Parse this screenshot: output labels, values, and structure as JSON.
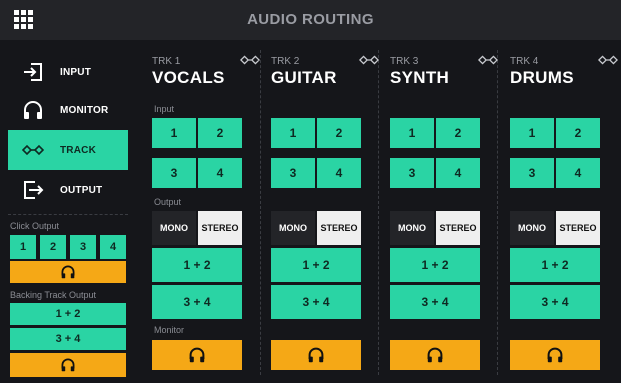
{
  "header": {
    "title": "AUDIO ROUTING",
    "menu_icon": "grid-menu-icon"
  },
  "sidebar": {
    "items": [
      {
        "label": "INPUT",
        "icon": "input-arrow-icon",
        "active": false
      },
      {
        "label": "MONITOR",
        "icon": "headphones-icon",
        "active": false
      },
      {
        "label": "TRACK",
        "icon": "track-routing-icon",
        "active": true
      },
      {
        "label": "OUTPUT",
        "icon": "output-arrow-icon",
        "active": false
      }
    ],
    "click_output": {
      "label": "Click Output",
      "buttons": [
        "1",
        "2",
        "3",
        "4"
      ],
      "monitor_icon": "headphones-icon"
    },
    "backing_track_output": {
      "label": "Backing Track Output",
      "buttons": [
        "1 + 2",
        "3 + 4"
      ],
      "monitor_icon": "headphones-icon"
    }
  },
  "labels": {
    "input": "Input",
    "output": "Output",
    "monitor": "Monitor"
  },
  "tracks": [
    {
      "num": "TRK 1",
      "name": "VOCALS",
      "inputs": [
        "1",
        "2",
        "3",
        "4"
      ],
      "mono": "MONO",
      "stereo": "STEREO",
      "outputs": [
        "1 + 2",
        "3 + 4"
      ]
    },
    {
      "num": "TRK 2",
      "name": "GUITAR",
      "inputs": [
        "1",
        "2",
        "3",
        "4"
      ],
      "mono": "MONO",
      "stereo": "STEREO",
      "outputs": [
        "1 + 2",
        "3 + 4"
      ]
    },
    {
      "num": "TRK 3",
      "name": "SYNTH",
      "inputs": [
        "1",
        "2",
        "3",
        "4"
      ],
      "mono": "MONO",
      "stereo": "STEREO",
      "outputs": [
        "1 + 2",
        "3 + 4"
      ]
    },
    {
      "num": "TRK 4",
      "name": "DRUMS",
      "inputs": [
        "1",
        "2",
        "3",
        "4"
      ],
      "mono": "MONO",
      "stereo": "STEREO",
      "outputs": [
        "1 + 2",
        "3 + 4"
      ]
    }
  ],
  "colors": {
    "accent": "#2ad4a4",
    "monitor": "#f5a816",
    "background": "#15161a",
    "header": "#232428"
  }
}
